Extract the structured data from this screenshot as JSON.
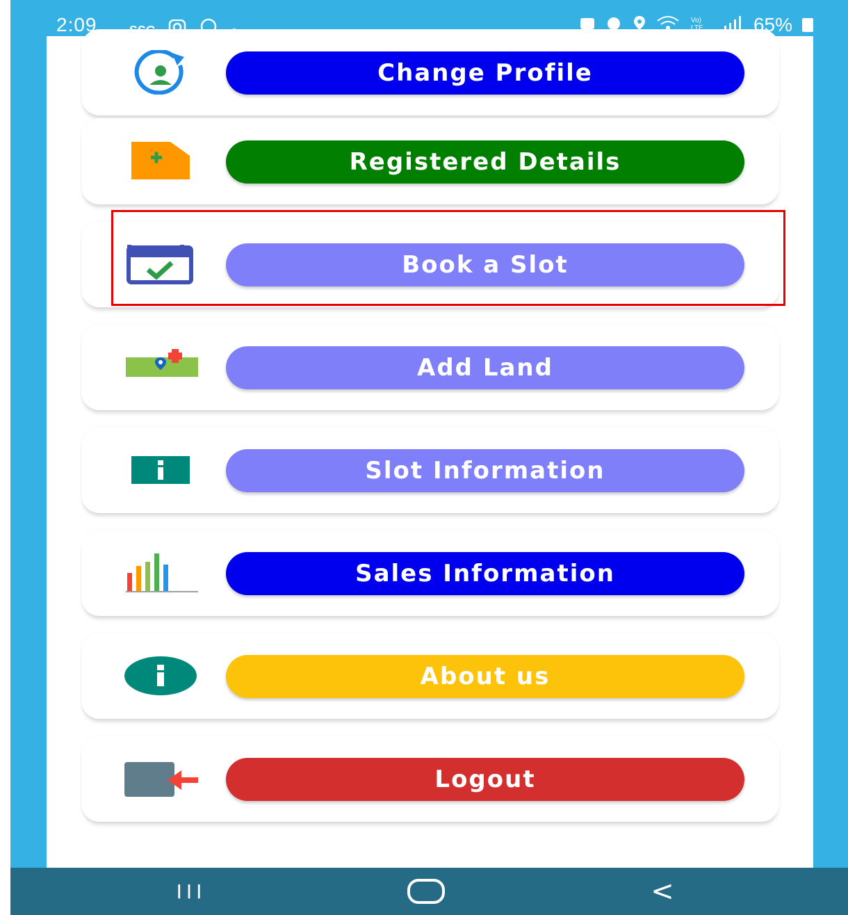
{
  "status_bar": {
    "time": "2:09",
    "left_icons": [
      "ssg-icon",
      "instagram-icon",
      "whatsapp-icon",
      "dot-icon"
    ],
    "right_icons": [
      "screenshot-icon",
      "alarm-icon",
      "location-icon",
      "wifi-icon",
      "volte-icon",
      "signal-icon"
    ],
    "battery": "65%"
  },
  "menu": {
    "items": [
      {
        "label": "Change Profile",
        "icon": "change-profile-icon",
        "color": "#0000ee"
      },
      {
        "label": "Registered Details",
        "icon": "document-add-icon",
        "color": "#007f00"
      },
      {
        "label": "Book a Slot",
        "icon": "calendar-check-icon",
        "color": "#7f7ffa"
      },
      {
        "label": "Add Land",
        "icon": "land-location-icon",
        "color": "#7f7ffa"
      },
      {
        "label": "Slot Information",
        "icon": "info-square-icon",
        "color": "#7f7ffa"
      },
      {
        "label": "Sales Information",
        "icon": "bar-chart-icon",
        "color": "#0000ee"
      },
      {
        "label": "About us",
        "icon": "info-circle-icon",
        "color": "#fcc30a"
      },
      {
        "label": "Logout",
        "icon": "logout-icon",
        "color": "#d32f2f"
      }
    ]
  },
  "highlighted_item": "Book a Slot",
  "nav_bar": {
    "recent": "III",
    "home": "home-icon",
    "back": "<"
  }
}
